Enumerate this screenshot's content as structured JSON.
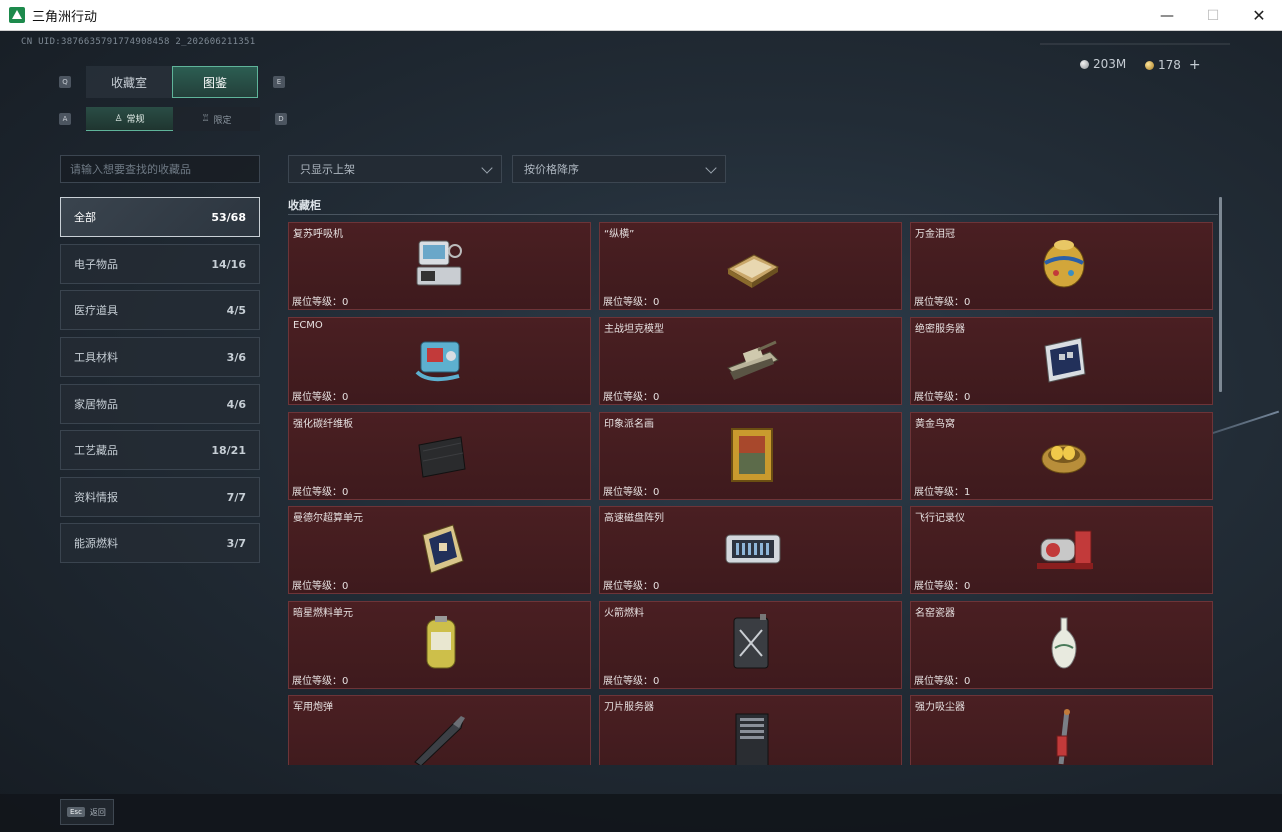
{
  "window": {
    "title": "三角洲行动",
    "min": "—",
    "max": "☐",
    "close": "✕"
  },
  "uid": "CN UID:3876635791774908458 2_202606211351",
  "currency": {
    "silver": "203M",
    "gold": "178",
    "plus": "+"
  },
  "tabs": {
    "main": [
      {
        "label": "收藏室",
        "key": "Q",
        "active": false
      },
      {
        "label": "图鉴",
        "key": "E",
        "active": true
      }
    ],
    "sub": [
      {
        "label": "常规",
        "key": "A",
        "active": true
      },
      {
        "label": "限定",
        "key": "D",
        "active": false
      }
    ]
  },
  "search": {
    "placeholder": "请输入想要查找的收藏品"
  },
  "filters": {
    "shelf": "只显示上架",
    "sort": "按价格降序"
  },
  "categories": [
    {
      "label": "全部",
      "count": "53/68",
      "active": true
    },
    {
      "label": "电子物品",
      "count": "14/16"
    },
    {
      "label": "医疗道具",
      "count": "4/5"
    },
    {
      "label": "工具材料",
      "count": "3/6"
    },
    {
      "label": "家居物品",
      "count": "4/6"
    },
    {
      "label": "工艺藏品",
      "count": "18/21"
    },
    {
      "label": "资料情报",
      "count": "7/7"
    },
    {
      "label": "能源燃料",
      "count": "3/7"
    }
  ],
  "section": {
    "title": "收藏柜"
  },
  "items": [
    {
      "name": "复苏呼吸机",
      "level": "展位等级：0",
      "icon": "ventilator-icon"
    },
    {
      "name": "“纵横”",
      "level": "展位等级：0",
      "icon": "chessboard-icon"
    },
    {
      "name": "万金泪冠",
      "level": "展位等级：0",
      "icon": "jeweled-egg-icon"
    },
    {
      "name": "ECMO",
      "level": "展位等级：0",
      "icon": "ecmo-icon"
    },
    {
      "name": "主战坦克模型",
      "level": "展位等级：0",
      "icon": "tank-icon"
    },
    {
      "name": "绝密服务器",
      "level": "展位等级：0",
      "icon": "server-board-icon"
    },
    {
      "name": "强化碳纤维板",
      "level": "展位等级：0",
      "icon": "carbon-plate-icon"
    },
    {
      "name": "印象派名画",
      "level": "展位等级：0",
      "icon": "painting-icon"
    },
    {
      "name": "黄金鸟窝",
      "level": "展位等级：1",
      "icon": "golden-nest-icon"
    },
    {
      "name": "曼德尔超算单元",
      "level": "展位等级：0",
      "icon": "compute-unit-icon"
    },
    {
      "name": "高速磁盘阵列",
      "level": "展位等级：0",
      "icon": "disk-array-icon"
    },
    {
      "name": "飞行记录仪",
      "level": "展位等级：0",
      "icon": "flight-recorder-icon"
    },
    {
      "name": "暗星燃料单元",
      "level": "展位等级：0",
      "icon": "fuel-cell-icon"
    },
    {
      "name": "火箭燃料",
      "level": "展位等级：0",
      "icon": "fuel-can-icon"
    },
    {
      "name": "名窑瓷器",
      "level": "展位等级：0",
      "icon": "porcelain-vase-icon"
    },
    {
      "name": "军用炮弹",
      "level": "",
      "icon": "shell-icon"
    },
    {
      "name": "刀片服务器",
      "level": "",
      "icon": "blade-server-icon"
    },
    {
      "name": "强力吸尘器",
      "level": "",
      "icon": "vacuum-icon"
    }
  ],
  "bottom": {
    "esc_key": "Esc",
    "back_label": "返回"
  }
}
